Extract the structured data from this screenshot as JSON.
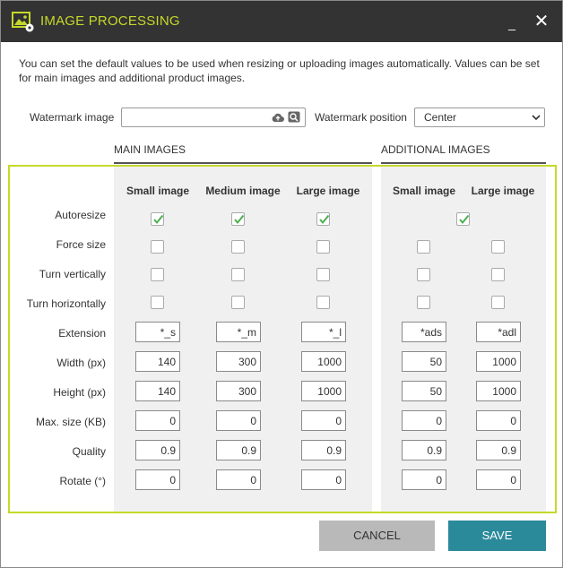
{
  "window": {
    "title": "IMAGE PROCESSING",
    "minimize_glyph": "_",
    "close_glyph": "✕"
  },
  "description": "You can set the default values to be used when resizing or uploading images automatically. Values can be set for main images and additional product images.",
  "watermark": {
    "image_label": "Watermark image",
    "image_value": "",
    "position_label": "Watermark position",
    "position_value": "Center"
  },
  "sections": {
    "main": "MAIN IMAGES",
    "additional": "ADDITIONAL IMAGES"
  },
  "columns": [
    "Small image",
    "Medium image",
    "Large image",
    "Small image",
    "Large image"
  ],
  "rows": {
    "autoresize": "Autoresize",
    "force_size": "Force size",
    "turn_vertically": "Turn vertically",
    "turn_horizontally": "Turn horizontally",
    "extension": "Extension",
    "width": "Width (px)",
    "height": "Height (px)",
    "max_size": "Max. size (KB)",
    "quality": "Quality",
    "rotate": "Rotate (°)"
  },
  "values": {
    "autoresize": [
      true,
      true,
      true,
      true
    ],
    "force_size": [
      false,
      false,
      false,
      false,
      false
    ],
    "turn_vertically": [
      false,
      false,
      false,
      false,
      false
    ],
    "turn_horizontally": [
      false,
      false,
      false,
      false,
      false
    ],
    "extension": [
      "*_s",
      "*_m",
      "*_l",
      "*ads",
      "*adl"
    ],
    "width": [
      "140",
      "300",
      "1000",
      "50",
      "1000"
    ],
    "height": [
      "140",
      "300",
      "1000",
      "50",
      "1000"
    ],
    "max_size": [
      "0",
      "0",
      "0",
      "0",
      "0"
    ],
    "quality": [
      "0.9",
      "0.9",
      "0.9",
      "0.9",
      "0.9"
    ],
    "rotate": [
      "0",
      "0",
      "0",
      "0",
      "0"
    ]
  },
  "buttons": {
    "cancel": "CANCEL",
    "save": "SAVE"
  },
  "colors": {
    "accent_green": "#c5d92a",
    "titlebar": "#333333",
    "save_button": "#2b8a9a",
    "cancel_button": "#b9b9b9",
    "check_mark": "#4caf50"
  }
}
